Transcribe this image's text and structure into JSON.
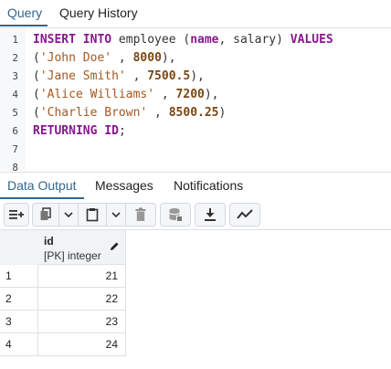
{
  "top_tabs": [
    {
      "label": "Query",
      "active": true
    },
    {
      "label": "Query History",
      "active": false
    }
  ],
  "editor": {
    "line_numbers": [
      "1",
      "2",
      "3",
      "4",
      "5",
      "6",
      "7",
      "8"
    ],
    "lines": [
      [
        {
          "t": "INSERT INTO",
          "c": "kw"
        },
        {
          "t": " employee (",
          "c": "idn"
        },
        {
          "t": "name",
          "c": "kw"
        },
        {
          "t": ", salary) ",
          "c": "idn"
        },
        {
          "t": "VALUES",
          "c": "kw"
        }
      ],
      [
        {
          "t": "(",
          "c": "pun"
        },
        {
          "t": "'John Doe'",
          "c": "str"
        },
        {
          "t": " , ",
          "c": "pun"
        },
        {
          "t": "8000",
          "c": "num"
        },
        {
          "t": "),",
          "c": "pun"
        }
      ],
      [
        {
          "t": "(",
          "c": "pun"
        },
        {
          "t": "'Jane Smith'",
          "c": "str"
        },
        {
          "t": " , ",
          "c": "pun"
        },
        {
          "t": "7500.5",
          "c": "num"
        },
        {
          "t": "),",
          "c": "pun"
        }
      ],
      [
        {
          "t": "(",
          "c": "pun"
        },
        {
          "t": "'Alice Williams'",
          "c": "str"
        },
        {
          "t": " , ",
          "c": "pun"
        },
        {
          "t": "7200",
          "c": "num"
        },
        {
          "t": "),",
          "c": "pun"
        }
      ],
      [
        {
          "t": "(",
          "c": "pun"
        },
        {
          "t": "'Charlie Brown'",
          "c": "str"
        },
        {
          "t": " , ",
          "c": "pun"
        },
        {
          "t": "8500.25",
          "c": "num"
        },
        {
          "t": ")",
          "c": "pun"
        }
      ],
      [
        {
          "t": "RETURNING",
          "c": "kw"
        },
        {
          "t": " ",
          "c": "idn"
        },
        {
          "t": "ID",
          "c": "kw"
        },
        {
          "t": ";",
          "c": "pun"
        }
      ],
      [],
      []
    ]
  },
  "bottom_tabs": [
    {
      "label": "Data Output",
      "active": true
    },
    {
      "label": "Messages",
      "active": false
    },
    {
      "label": "Notifications",
      "active": false
    }
  ],
  "toolbar": {
    "icons": [
      "add-row-icon",
      "copy-icon",
      "chevron-down-icon",
      "paste-icon",
      "chevron-down-icon",
      "delete-icon",
      "save-data-icon",
      "download-icon",
      "graph-icon"
    ]
  },
  "grid": {
    "column": {
      "name": "id",
      "type": "[PK] integer"
    },
    "rows": [
      {
        "num": "1",
        "id": "21"
      },
      {
        "num": "2",
        "id": "22"
      },
      {
        "num": "3",
        "id": "23"
      },
      {
        "num": "4",
        "id": "24"
      }
    ]
  },
  "colors": {
    "accent": "#326690",
    "keyword": "#8a1690",
    "string": "#a4571f",
    "number": "#7a4710"
  }
}
